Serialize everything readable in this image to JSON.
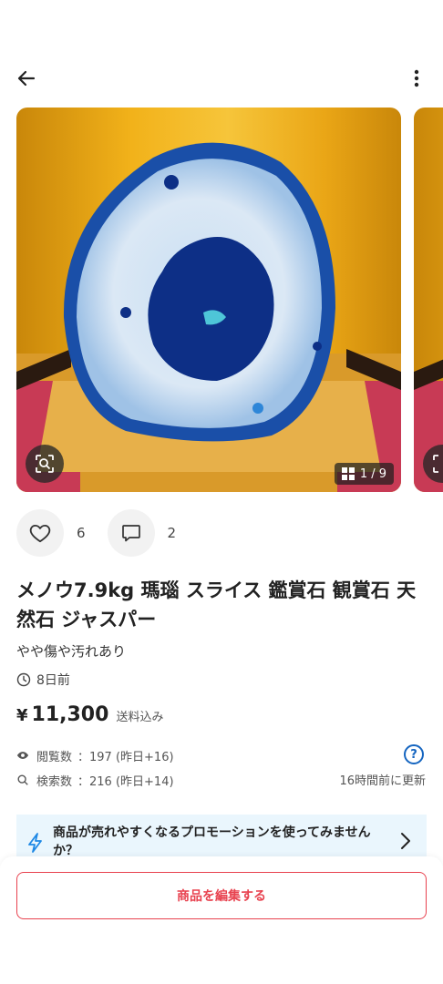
{
  "header": {
    "back_icon": "arrow-left-icon",
    "menu_icon": "more-vertical-icon"
  },
  "gallery": {
    "counter": "1 / 9",
    "counter_icon": "grid-icon",
    "lens_icon": "image-search-icon"
  },
  "actions": {
    "likes": "6",
    "comments": "2",
    "like_icon": "heart-icon",
    "comment_icon": "comment-icon"
  },
  "item": {
    "title": "メノウ7.9kg 瑪瑙 スライス 鑑賞石 観賞石 天然石 ジャスパー",
    "condition": "やや傷や汚れあり",
    "posted": "8日前",
    "currency": "¥",
    "price": "11,300",
    "shipping": "送料込み"
  },
  "stats": {
    "views_label": "閲覧数",
    "views_value": "：197 (昨日+16)",
    "search_label": "検索数",
    "search_value": "：216 (昨日+14)",
    "updated": "16時間前に更新",
    "help": "?"
  },
  "promo": {
    "text": "商品が売れやすくなるプロモーションを使ってみませんか？"
  },
  "footer": {
    "edit_label": "商品を編集する"
  },
  "colors": {
    "accent": "#e8424f",
    "link_blue": "#1565c0",
    "promo_bg": "#eaf6fd"
  }
}
